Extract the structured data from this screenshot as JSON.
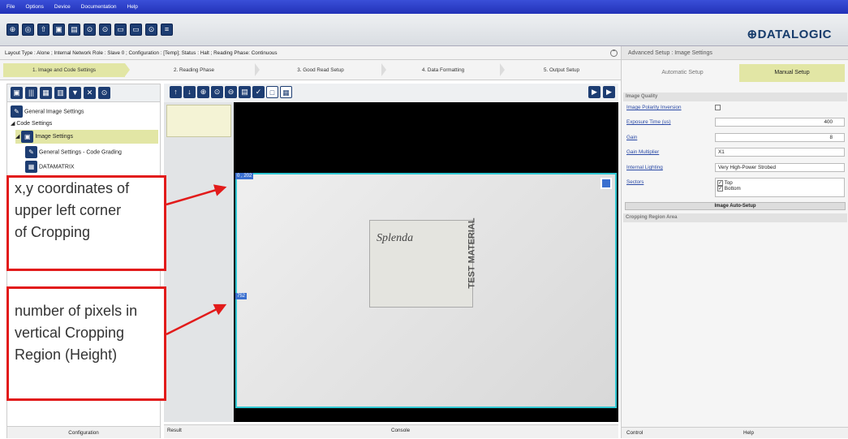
{
  "menu": {
    "file": "File",
    "options": "Options",
    "device": "Device",
    "documentation": "Documentation",
    "help": "Help"
  },
  "brand": {
    "logo": "⊕DATALOGIC",
    "accent": "#1d3d72"
  },
  "status": {
    "text": "Layout Type : Alone ; Internal Network Role : Slave 0 ; Configuration : [Temp]; Status : Halt ; Reading Phase: Continuous"
  },
  "steps": [
    "1. Image and Code Settings",
    "2. Reading Phase",
    "3. Good Read Setup",
    "4. Data Formatting",
    "5. Output Setup"
  ],
  "tree": {
    "general_image": "General Image Settings",
    "code_settings": "Code Settings",
    "image_settings": "Image Settings",
    "code_grading": "General Settings - Code Grading",
    "datamatrix": "DATAMATRIX"
  },
  "left_footer": "Configuration",
  "viewer": {
    "coord_top": "0 , 202",
    "coord_height": "752",
    "result_tab": "Result",
    "console_tab": "Console"
  },
  "label_text": {
    "brand": "Splenda",
    "vertical": "TEST MATERIAL"
  },
  "right": {
    "header": "Advanced Setup : Image Settings",
    "automatic": "Automatic Setup",
    "manual": "Manual Setup",
    "image_quality": "Image Quality",
    "polarity": "Image Polarity Inversion",
    "exposure": "Exposure Time (us)",
    "exposure_val": "400",
    "gain": "Gain",
    "gain_val": "8",
    "gain_mult": "Gain Multiplier",
    "gain_mult_val": "X1",
    "lighting": "Internal Lighting",
    "lighting_val": "Very High-Power Strobed",
    "sectors": "Sectors",
    "top": "Top",
    "bottom": "Bottom",
    "auto_setup": "Image Auto-Setup",
    "cropping": "Cropping Region Area",
    "control_tab": "Control",
    "help_tab": "Help"
  },
  "annotations": {
    "a1": [
      "x,y coordinates of",
      "upper left corner",
      "of Cropping"
    ],
    "a2": [
      "number of pixels in",
      "vertical Cropping",
      "Region (Height)"
    ]
  }
}
